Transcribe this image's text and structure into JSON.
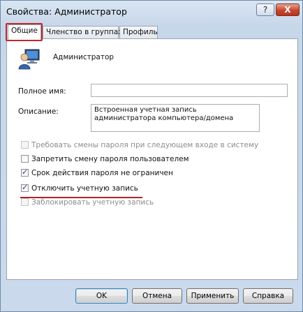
{
  "window": {
    "title": "Свойства: Администратор",
    "help_label": "?",
    "close_label": "X"
  },
  "tabs": [
    {
      "label": "Общие",
      "active": true
    },
    {
      "label": "Членство в группах",
      "active": false
    },
    {
      "label": "Профиль",
      "active": false
    }
  ],
  "general": {
    "user_icon": "user-computer-icon",
    "username": "Администратор",
    "full_name_label": "Полное имя:",
    "full_name_value": "",
    "description_label": "Описание:",
    "description_value": "Встроенная учетная запись администратора компьютера/домена"
  },
  "options": [
    {
      "label": "Требовать смены пароля при следующем входе в систему",
      "checked": false,
      "disabled": true
    },
    {
      "label": "Запретить смену пароля пользователем",
      "checked": false,
      "disabled": false
    },
    {
      "label": "Срок действия пароля не ограничен",
      "checked": true,
      "disabled": false
    },
    {
      "label": "Отключить учетную запись",
      "checked": true,
      "disabled": false
    },
    {
      "label": "Заблокировать учетную запись",
      "checked": false,
      "disabled": true
    }
  ],
  "buttons": {
    "ok": "OK",
    "cancel": "Отмена",
    "apply": "Применить",
    "help": "Справка"
  },
  "colors": {
    "highlight": "#c0282d"
  }
}
